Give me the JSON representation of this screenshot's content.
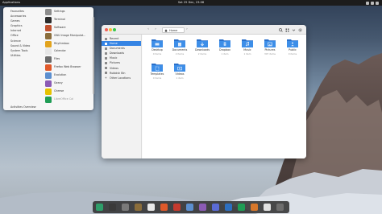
{
  "topbar": {
    "activities": "Applications",
    "clock": "Sat 25 Dec, 23:08",
    "tray_icons": [
      "network-icon",
      "volume-icon",
      "power-icon"
    ]
  },
  "app_menu": {
    "categories": [
      "Favourites",
      "Accessories",
      "Games",
      "Graphics",
      "Internet",
      "Office",
      "Science",
      "Sound & Video",
      "System Tools",
      "Utilities"
    ],
    "apps": [
      {
        "label": "Settings",
        "icon": "settings-icon",
        "color": "#8c8c8c"
      },
      {
        "label": "Terminal",
        "icon": "terminal-icon",
        "color": "#2b2b2b"
      },
      {
        "label": "Software",
        "icon": "software-icon",
        "color": "#c0502e"
      },
      {
        "label": "GNU Image Manipulat...",
        "icon": "gimp-icon",
        "color": "#8a6d3b"
      },
      {
        "label": "Rhythmbox",
        "icon": "rhythmbox-icon",
        "color": "#e2a31c"
      },
      {
        "label": "Calendar",
        "icon": "calendar-icon",
        "color": "#e6e6e6"
      },
      {
        "label": "Files",
        "icon": "files-icon",
        "color": "#6a6a6a"
      },
      {
        "label": "Firefox Web Browser",
        "icon": "firefox-icon",
        "color": "#e0592a"
      },
      {
        "label": "Evolution",
        "icon": "evolution-icon",
        "color": "#5c8fcf"
      },
      {
        "label": "Geany",
        "icon": "geany-icon",
        "color": "#8b5bb5"
      },
      {
        "label": "Cheese",
        "icon": "cheese-icon",
        "color": "#e6c200"
      },
      {
        "label": "LibreOffice Cal",
        "icon": "libreoffice-calc-icon",
        "color": "#1f9d55"
      }
    ],
    "footer": "Activities Overview"
  },
  "file_manager": {
    "path_label": "Home",
    "sidebar": [
      {
        "label": "Recent",
        "icon": "recent-icon",
        "active": false
      },
      {
        "label": "Home",
        "icon": "home-icon",
        "active": true
      },
      {
        "label": "Documents",
        "icon": "documents-icon",
        "active": false
      },
      {
        "label": "Downloads",
        "icon": "downloads-icon",
        "active": false
      },
      {
        "label": "Music",
        "icon": "music-icon",
        "active": false
      },
      {
        "label": "Pictures",
        "icon": "pictures-icon",
        "active": false
      },
      {
        "label": "Videos",
        "icon": "videos-icon",
        "active": false
      },
      {
        "label": "Rubbish Bin",
        "icon": "trash-icon",
        "active": false
      },
      {
        "label": "Other Locations",
        "icon": "other-locations-icon",
        "active": false
      }
    ],
    "folders": [
      {
        "name": "Desktop",
        "sub": "0 items",
        "icon": "desktop-folder-icon"
      },
      {
        "name": "Documents",
        "sub": "2 items",
        "icon": "documents-folder-icon"
      },
      {
        "name": "Downloads",
        "sub": "2 items",
        "icon": "downloads-folder-icon"
      },
      {
        "name": "Dropbox",
        "sub": "1 item",
        "icon": "dropbox-folder-icon"
      },
      {
        "name": "Music",
        "sub": "1 item",
        "icon": "music-folder-icon"
      },
      {
        "name": "Pictures",
        "sub": "307 items",
        "icon": "pictures-folder-icon"
      },
      {
        "name": "Public",
        "sub": "0 items",
        "icon": "public-folder-icon"
      },
      {
        "name": "Templates",
        "sub": "0 items",
        "icon": "templates-folder-icon"
      },
      {
        "name": "Videos",
        "sub": "1 item",
        "icon": "videos-folder-icon"
      }
    ]
  },
  "dock": [
    {
      "icon": "home-folder-icon",
      "color": "#2f9e6a"
    },
    {
      "icon": "terminal-icon",
      "color": "#3a3a3a"
    },
    {
      "icon": "files-icon",
      "color": "#7a7a7a"
    },
    {
      "icon": "gimp-icon",
      "color": "#8a6d3b"
    },
    {
      "icon": "calendar-icon",
      "color": "#e9e9e9"
    },
    {
      "icon": "firefox-icon",
      "color": "#e0592a"
    },
    {
      "icon": "software-icon",
      "color": "#c63a2e"
    },
    {
      "icon": "evolution-icon",
      "color": "#5c8fcf"
    },
    {
      "icon": "geany-icon",
      "color": "#8b5bb5"
    },
    {
      "icon": "discord-icon",
      "color": "#5a6bd6"
    },
    {
      "icon": "libreoffice-writer-icon",
      "color": "#2d6fbf"
    },
    {
      "icon": "libreoffice-calc-icon",
      "color": "#1f9d55"
    },
    {
      "icon": "libreoffice-impress-icon",
      "color": "#d9782b"
    },
    {
      "icon": "text-editor-icon",
      "color": "#e3e3e3"
    },
    {
      "icon": "apps-grid-icon",
      "color": "#6e6e6e"
    }
  ],
  "colors": {
    "accent": "#3584e4",
    "folder": "#3d8ee8",
    "folder_dark": "#2a6fc9"
  }
}
